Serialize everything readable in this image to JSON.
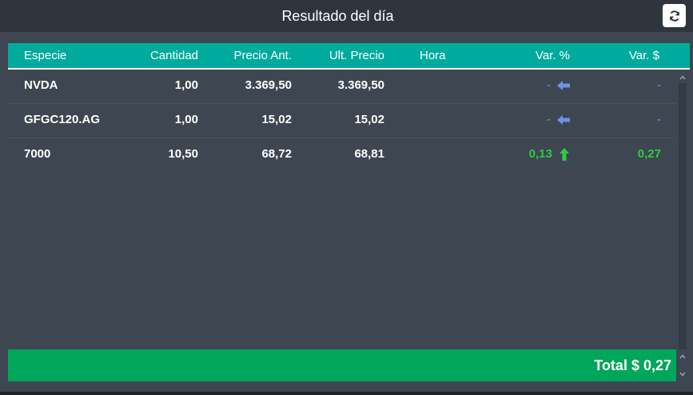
{
  "header": {
    "title": "Resultado del día",
    "refresh_icon": "refresh-icon"
  },
  "table": {
    "columns": [
      "Especie",
      "Cantidad",
      "Precio Ant.",
      "Ult. Precio",
      "Hora",
      "Var. %",
      "Var. $"
    ],
    "rows": [
      {
        "especie": "NVDA",
        "cantidad": "1,00",
        "precio_ant": "3.369,50",
        "ult_precio": "3.369,50",
        "hora": "",
        "var_pct": "-",
        "var_pct_icon": "arrow-left-icon",
        "var_usd": "-",
        "status": "neutral"
      },
      {
        "especie": "GFGC120.AG",
        "cantidad": "1,00",
        "precio_ant": "15,02",
        "ult_precio": "15,02",
        "hora": "",
        "var_pct": "-",
        "var_pct_icon": "arrow-left-icon",
        "var_usd": "-",
        "status": "neutral"
      },
      {
        "especie": "7000",
        "cantidad": "10,50",
        "precio_ant": "68,72",
        "ult_precio": "68,81",
        "hora": "",
        "var_pct": "0,13",
        "var_pct_icon": "arrow-up-icon",
        "var_usd": "0,27",
        "status": "positive"
      }
    ]
  },
  "footer": {
    "total": "Total $ 0,27"
  },
  "colors": {
    "header_bg": "#00ab9d",
    "footer_bg": "#00a65a",
    "neutral": "#6a93e8",
    "positive": "#2ecc40",
    "panel_bg": "#3e4651"
  }
}
